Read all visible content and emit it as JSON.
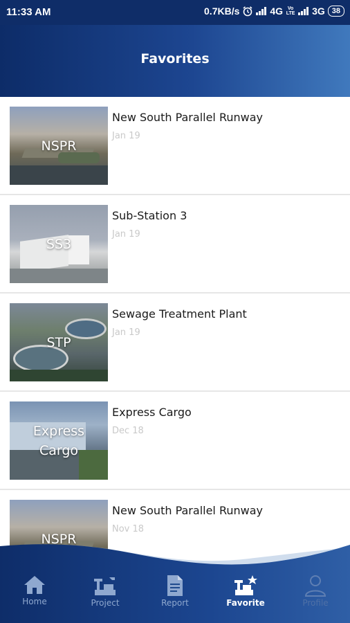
{
  "status_bar": {
    "time": "11:33 AM",
    "speed": "0.7KB/s",
    "network_1": "4G",
    "volte": "Vo LTE",
    "network_2": "3G",
    "battery": "38",
    "alarm_icon": "alarm-clock-icon",
    "signal_icon": "signal-bars-icon"
  },
  "header": {
    "title": "Favorites"
  },
  "favorites": [
    {
      "thumb_label": "NSPR",
      "title": "New South Parallel Runway",
      "date": "Jan 19"
    },
    {
      "thumb_label": "SS3",
      "title": "Sub-Station 3",
      "date": "Jan 19"
    },
    {
      "thumb_label": "STP",
      "title": "Sewage Treatment Plant",
      "date": "Jan 19"
    },
    {
      "thumb_label": "Express Cargo",
      "title": "Express Cargo",
      "date": "Dec 18"
    },
    {
      "thumb_label": "NSPR",
      "title": "New South Parallel Runway",
      "date": "Nov 18"
    }
  ],
  "bottom_nav": {
    "items": [
      {
        "label": "Home",
        "icon": "home-icon",
        "active": false
      },
      {
        "label": "Project",
        "icon": "project-icon",
        "active": false
      },
      {
        "label": "Report",
        "icon": "report-icon",
        "active": false
      },
      {
        "label": "Favorite",
        "icon": "favorite-icon",
        "active": true
      },
      {
        "label": "Profile",
        "icon": "profile-icon",
        "active": false
      }
    ]
  },
  "colors": {
    "header_start": "#0d2c68",
    "header_end": "#4079bd",
    "nav_inactive": "#8fa8cf",
    "nav_active": "#ffffff",
    "date_text": "#c9c9c9"
  }
}
